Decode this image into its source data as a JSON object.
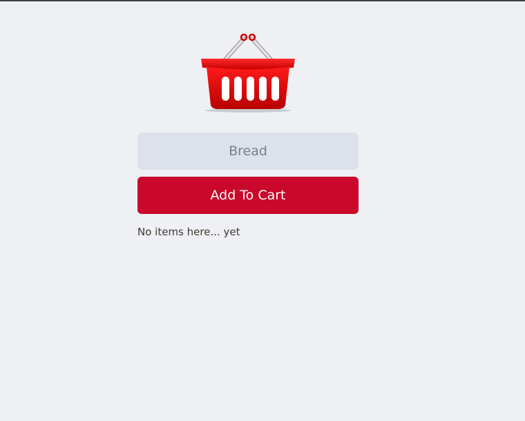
{
  "cart": {
    "logo_icon": "shopping-basket-icon",
    "input_value": "",
    "input_placeholder": "Bread",
    "add_button_label": "Add To Cart",
    "empty_message": "No items here... yet"
  },
  "colors": {
    "background": "#eef0f4",
    "input_background": "#dde1ea",
    "accent": "#c9082b",
    "basket_red": "#e00000"
  }
}
